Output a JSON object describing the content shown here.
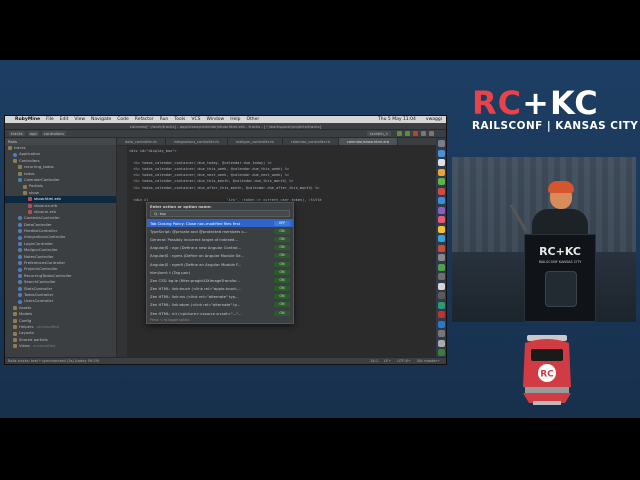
{
  "logo": {
    "rc": "RC",
    "plus": "+",
    "kc": "KC",
    "subtitle": "RAILSCONF | KANSAS CITY"
  },
  "podium": {
    "logo": "RC+KC",
    "subtitle": "RAILSCONF KANSAS CITY"
  },
  "menubar": {
    "app": "RubyMine",
    "items": [
      "File",
      "Edit",
      "View",
      "Navigate",
      "Code",
      "Refactor",
      "Run",
      "Tools",
      "VCS",
      "Window",
      "Help",
      "Other"
    ],
    "clock": "Thu 5 May 11:04",
    "user": "vwaggi"
  },
  "window_title": "calendar[~/work/tracks] - app/views/calendar/show.html.erb - tracks - [~/workspace/projects/tracks]",
  "navbar": {
    "crumbs": [
      "tracks",
      "app",
      "controllers"
    ],
    "run_config": "scratch_1"
  },
  "sidebar": {
    "header": "Rails",
    "items": [
      {
        "label": "tracks",
        "kind": "folder",
        "depth": 0
      },
      {
        "label": "Application",
        "kind": "ctrl",
        "depth": 1
      },
      {
        "label": "Controllers",
        "kind": "folder",
        "depth": 1
      },
      {
        "label": "recurring_todos",
        "kind": "folder",
        "depth": 2
      },
      {
        "label": "todos",
        "kind": "folder",
        "depth": 2
      },
      {
        "label": "CalendarController",
        "kind": "ctrl",
        "depth": 2
      },
      {
        "label": "Partials",
        "kind": "folder",
        "depth": 3
      },
      {
        "label": "show",
        "kind": "folder",
        "depth": 3
      },
      {
        "label": "show.html.erb",
        "kind": "file",
        "depth": 4,
        "selected": true
      },
      {
        "label": "show.ics.erb",
        "kind": "file",
        "depth": 4
      },
      {
        "label": "show.m.erb",
        "kind": "file",
        "depth": 4
      },
      {
        "label": "ContextsController",
        "kind": "ctrl",
        "depth": 2
      },
      {
        "label": "DataController",
        "kind": "ctrl",
        "depth": 2
      },
      {
        "label": "FeedlistController",
        "kind": "ctrl",
        "depth": 2
      },
      {
        "label": "IntegrationsController",
        "kind": "ctrl",
        "depth": 2
      },
      {
        "label": "LoginController",
        "kind": "ctrl",
        "depth": 2
      },
      {
        "label": "MailgunController",
        "kind": "ctrl",
        "depth": 2
      },
      {
        "label": "NotesController",
        "kind": "ctrl",
        "depth": 2
      },
      {
        "label": "PreferencesController",
        "kind": "ctrl",
        "depth": 2
      },
      {
        "label": "ProjectsController",
        "kind": "ctrl",
        "depth": 2
      },
      {
        "label": "RecurringTodosController",
        "kind": "ctrl",
        "depth": 2
      },
      {
        "label": "SearchController",
        "kind": "ctrl",
        "depth": 2
      },
      {
        "label": "StatsController",
        "kind": "ctrl",
        "depth": 2
      },
      {
        "label": "TodosController",
        "kind": "ctrl",
        "depth": 2
      },
      {
        "label": "UsersController",
        "kind": "ctrl",
        "depth": 2
      },
      {
        "label": "Assets",
        "kind": "folder",
        "depth": 1
      },
      {
        "label": "Models",
        "kind": "folder",
        "depth": 1
      },
      {
        "label": "Config",
        "kind": "folder",
        "depth": 1
      },
      {
        "label": "Helpers",
        "kind": "folder",
        "depth": 1,
        "tag": "unclassified"
      },
      {
        "label": "Layouts",
        "kind": "folder",
        "depth": 1
      },
      {
        "label": "Shared partials",
        "kind": "folder",
        "depth": 1
      },
      {
        "label": "Views",
        "kind": "folder",
        "depth": 1,
        "tag": "unclassified"
      }
    ]
  },
  "tabs": [
    {
      "label": "data_controller.rb",
      "active": false
    },
    {
      "label": "integrations_controller.rb",
      "active": false
    },
    {
      "label": "mailgun_controller.rb",
      "active": false
    },
    {
      "label": "calendar_controller.rb",
      "active": false
    },
    {
      "label": "calendar/show.html.erb",
      "active": true
    }
  ],
  "code_lines": [
    "<div id=\"display_box\">",
    "",
    "  <%= todos_calendar_container(:due_today, @calendar.due_today) %>",
    "  <%= todos_calendar_container(:due_this_week, @calendar.due_this_week) %>",
    "  <%= todos_calendar_container(:due_next_week, @calendar.due_next_week) %>",
    "  <%= todos_calendar_container(:due_this_month, @calendar.due_this_month) %>",
    "  <%= todos_calendar_container(:due_after_this_month, @calendar.due_after_this_month) %>",
    "",
    "  <div cl                                    'ics', :token => current_user.token), :title"
  ],
  "popup": {
    "title": "Enter action or option name:",
    "query": "Q- top",
    "footer": "Press ⌥ to toggle option",
    "rows": [
      {
        "label": "Tab Closing Policy: Close non-modified files first",
        "state": "OFF",
        "selected": true
      },
      {
        "label": "TypeScript: @private and @protected members s...",
        "state": "ON"
      },
      {
        "label": "General: Possibly incorrect target of indexed...",
        "state": "ON"
      },
      {
        "label": "AngularJS : ngc (Define a new Angular Control...",
        "state": "ON"
      },
      {
        "label": "AngularJS : ngms (Define an Angular Module Se...",
        "state": "ON"
      },
      {
        "label": "AngularJS : ngmfi (Define an Angular Module F...",
        "state": "ON"
      },
      {
        "label": "html/xml: t (Tag pair)",
        "state": "ON"
      },
      {
        "label": "Zen CSS: bg:ie (filter:progid:DXImageTransfor...",
        "state": "ON"
      },
      {
        "label": "Zen HTML: link:touch (<link rel=\"apple-touch-...",
        "state": "ON"
      },
      {
        "label": "Zen HTML: link:rss (<link rel=\"alternate\" typ...",
        "state": "ON"
      },
      {
        "label": "Zen HTML: link:atom (<link rel=\"alternate\" ty...",
        "state": "ON"
      },
      {
        "label": "Zen HTML: ri:t (<picture><source srcset=\"...\"...",
        "state": "ON"
      }
    ]
  },
  "statusbar": {
    "left": "Rails tracks: test * synchronized (3s) (today 09:29)",
    "pos": "14:1",
    "lf": "LF÷",
    "enc": "UTF-8÷",
    "git": "Git: master÷"
  },
  "colors": {
    "accent_red": "#e7434b",
    "bg_blue": "#1d3e63",
    "ide_bg": "#2b2b2b"
  }
}
